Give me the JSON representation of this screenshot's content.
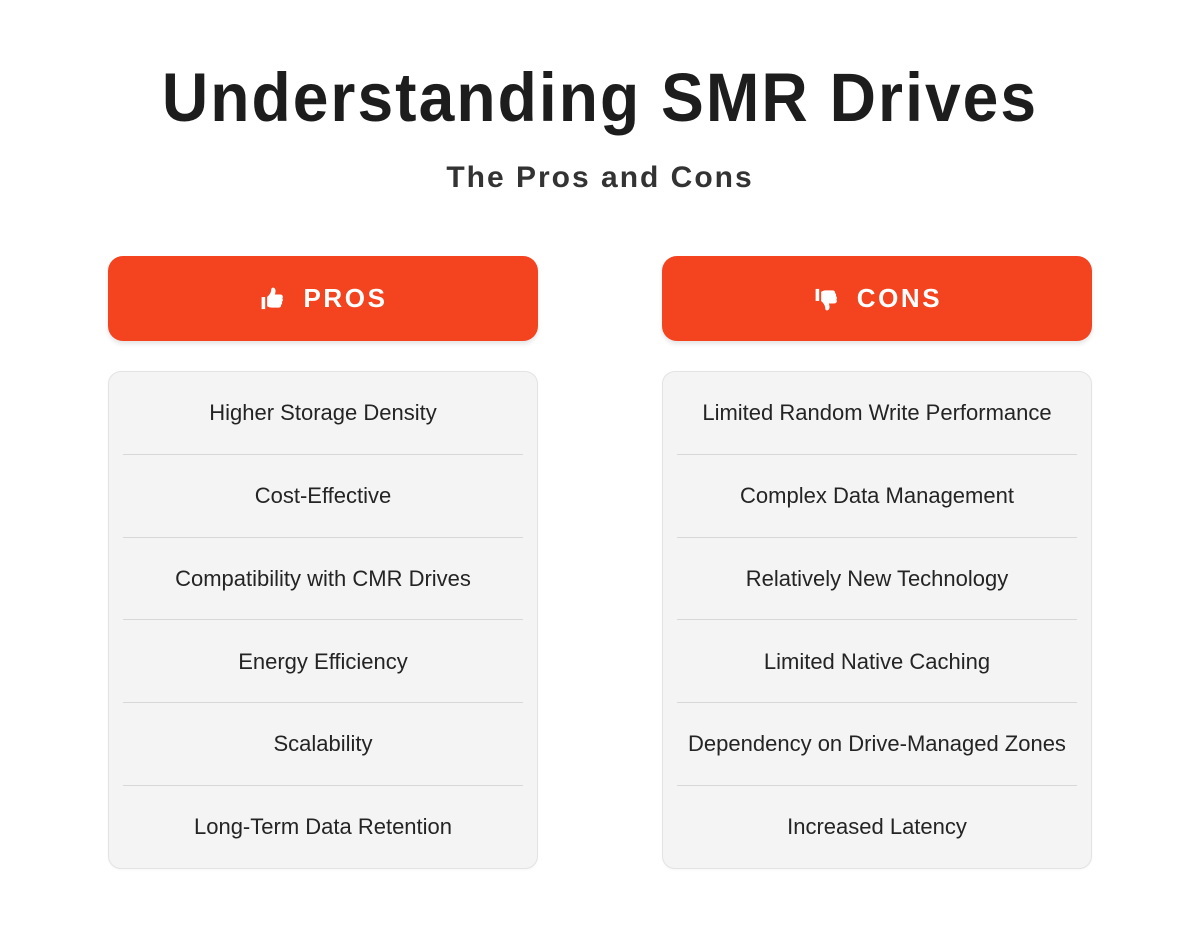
{
  "heading": {
    "title": "Understanding SMR Drives",
    "subtitle": "The Pros and Cons"
  },
  "colors": {
    "accent": "#f4431f",
    "panel_background": "#f4f4f4",
    "panel_border": "#e3e3e3",
    "divider": "#d8d8d8",
    "title_text": "#1d1d1d",
    "subtitle_text": "#333333",
    "item_text": "#242424",
    "header_text": "#ffffff",
    "page_background": "#ffffff"
  },
  "columns": [
    {
      "id": "pros",
      "header": {
        "label": "PROS",
        "icon": "thumbs-up-icon"
      },
      "items": [
        "Higher Storage Density",
        "Cost-Effective",
        "Compatibility with CMR Drives",
        "Energy Efficiency",
        "Scalability",
        "Long-Term Data Retention"
      ]
    },
    {
      "id": "cons",
      "header": {
        "label": "CONS",
        "icon": "thumbs-down-icon"
      },
      "items": [
        "Limited Random Write Performance",
        "Complex Data Management",
        "Relatively New Technology",
        "Limited Native Caching",
        "Dependency on Drive-Managed Zones",
        "Increased Latency"
      ]
    }
  ]
}
